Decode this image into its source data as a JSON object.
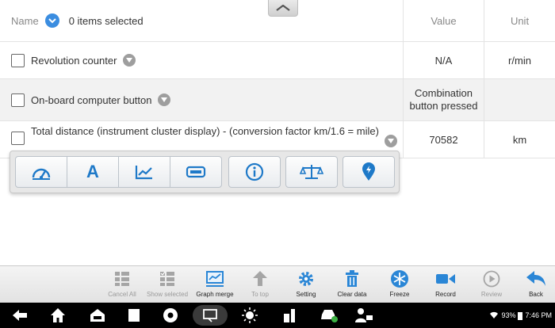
{
  "table": {
    "header": {
      "name_label": "Name",
      "selected_text": "0 items selected",
      "value_label": "Value",
      "unit_label": "Unit"
    },
    "rows": [
      {
        "name": "Revolution counter",
        "value": "N/A",
        "unit": "r/min"
      },
      {
        "name": "On-board computer button",
        "value": "Combination button pressed",
        "unit": ""
      },
      {
        "name": "Total distance (instrument cluster display) - (conversion factor km/1.6 = mile)",
        "value": "70582",
        "unit": "km"
      }
    ]
  },
  "popup": {
    "buttons": [
      "gauge-icon",
      "text-icon",
      "line-graph-icon",
      "digital-display-icon",
      "info-icon",
      "range-scale-icon",
      "location-pin-icon"
    ]
  },
  "toolbar": {
    "items": [
      {
        "label": "Cancel All",
        "icon": "grid-cancel-icon",
        "enabled": false
      },
      {
        "label": "Show selected",
        "icon": "grid-check-icon",
        "enabled": false
      },
      {
        "label": "Graph merge",
        "icon": "graph-merge-icon",
        "enabled": true
      },
      {
        "label": "To top",
        "icon": "to-top-icon",
        "enabled": false
      },
      {
        "label": "Setting",
        "icon": "gear-icon",
        "enabled": true
      },
      {
        "label": "Clear data",
        "icon": "trash-icon",
        "enabled": true
      },
      {
        "label": "Freeze",
        "icon": "snowflake-icon",
        "enabled": true
      },
      {
        "label": "Record",
        "icon": "video-camera-icon",
        "enabled": true
      },
      {
        "label": "Review",
        "icon": "play-circle-icon",
        "enabled": false
      },
      {
        "label": "Back",
        "icon": "back-arrow-icon",
        "enabled": true
      }
    ]
  },
  "status_bar": {
    "battery": "93%",
    "time": "7:46 PM"
  },
  "colors": {
    "accent_blue": "#3b8de0",
    "nav_background": "#000000"
  }
}
